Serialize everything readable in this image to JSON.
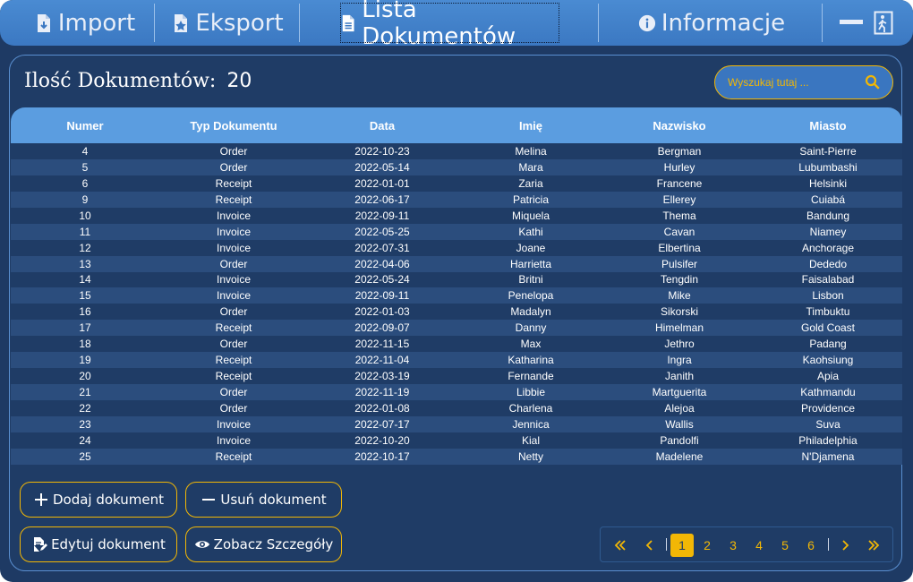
{
  "nav": {
    "tabs": [
      {
        "label": "Import",
        "icon": "file-import-icon"
      },
      {
        "label": "Eksport",
        "icon": "file-export-icon"
      },
      {
        "label": "Lista Dokumentów",
        "icon": "document-icon",
        "active": true
      },
      {
        "label": "Informacje",
        "icon": "info-icon"
      }
    ],
    "minimize_icon": "minimize-icon",
    "exit_icon": "exit-door-icon"
  },
  "header": {
    "count_label": "Ilość Dokumentów:",
    "count_value": "20"
  },
  "search": {
    "placeholder": "Wyszukaj tutaj ..."
  },
  "table": {
    "columns": [
      "Numer",
      "Typ Dokumentu",
      "Data",
      "Imię",
      "Nazwisko",
      "Miasto"
    ],
    "rows": [
      [
        "4",
        "Order",
        "2022-10-23",
        "Melina",
        "Bergman",
        "Saint-Pierre"
      ],
      [
        "5",
        "Order",
        "2022-05-14",
        "Mara",
        "Hurley",
        "Lubumbashi"
      ],
      [
        "6",
        "Receipt",
        "2022-01-01",
        "Zaria",
        "Francene",
        "Helsinki"
      ],
      [
        "9",
        "Receipt",
        "2022-06-17",
        "Patricia",
        "Ellerey",
        "Cuiabá"
      ],
      [
        "10",
        "Invoice",
        "2022-09-11",
        "Miquela",
        "Thema",
        "Bandung"
      ],
      [
        "11",
        "Invoice",
        "2022-05-25",
        "Kathi",
        "Cavan",
        "Niamey"
      ],
      [
        "12",
        "Invoice",
        "2022-07-31",
        "Joane",
        "Elbertina",
        "Anchorage"
      ],
      [
        "13",
        "Order",
        "2022-04-06",
        "Harrietta",
        "Pulsifer",
        "Dededo"
      ],
      [
        "14",
        "Invoice",
        "2022-05-24",
        "Britni",
        "Tengdin",
        "Faisalabad"
      ],
      [
        "15",
        "Invoice",
        "2022-09-11",
        "Penelopa",
        "Mike",
        "Lisbon"
      ],
      [
        "16",
        "Order",
        "2022-01-03",
        "Madalyn",
        "Sikorski",
        "Timbuktu"
      ],
      [
        "17",
        "Receipt",
        "2022-09-07",
        "Danny",
        "Himelman",
        "Gold Coast"
      ],
      [
        "18",
        "Order",
        "2022-11-15",
        "Max",
        "Jethro",
        "Padang"
      ],
      [
        "19",
        "Receipt",
        "2022-11-04",
        "Katharina",
        "Ingra",
        "Kaohsiung"
      ],
      [
        "20",
        "Receipt",
        "2022-03-19",
        "Fernande",
        "Janith",
        "Apia"
      ],
      [
        "21",
        "Order",
        "2022-11-19",
        "Libbie",
        "Martguerita",
        "Kathmandu"
      ],
      [
        "22",
        "Order",
        "2022-01-08",
        "Charlena",
        "Alejoa",
        "Providence"
      ],
      [
        "23",
        "Invoice",
        "2022-07-17",
        "Jennica",
        "Wallis",
        "Suva"
      ],
      [
        "24",
        "Invoice",
        "2022-10-20",
        "Kial",
        "Pandolfi",
        "Philadelphia"
      ],
      [
        "25",
        "Receipt",
        "2022-10-17",
        "Netty",
        "Madelene",
        "N'Djamena"
      ]
    ]
  },
  "actions": {
    "add": "Dodaj dokument",
    "remove": "Usuń dokument",
    "edit": "Edytuj dokument",
    "details": "Zobacz Szczegóły"
  },
  "pagination": {
    "pages": [
      "1",
      "2",
      "3",
      "4",
      "5",
      "6"
    ],
    "current": "1"
  },
  "colors": {
    "accent": "#f2b705",
    "background": "#1e3a64",
    "header_blue": "#5b9de0"
  }
}
